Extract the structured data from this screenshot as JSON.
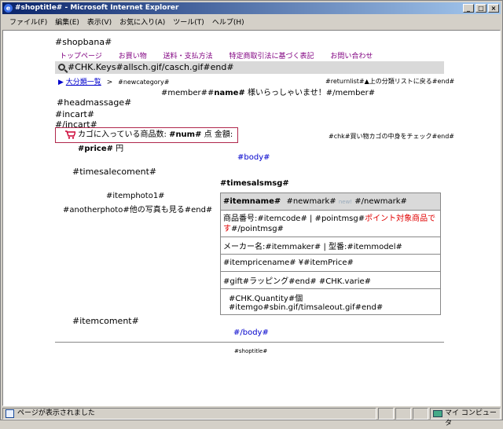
{
  "window": {
    "title": "#shoptitle# - Microsoft Internet Explorer",
    "buttons": [
      "_",
      "□",
      "×"
    ]
  },
  "menu": [
    "ファイル(F)",
    "編集(E)",
    "表示(V)",
    "お気に入り(A)",
    "ツール(T)",
    "ヘルプ(H)"
  ],
  "page": {
    "shopbana": "#shopbana#",
    "nav": [
      "トップページ",
      "お買い物",
      "送料・支払方法",
      "特定商取引法に基づく表記",
      "お問い合わせ"
    ],
    "search": "#CHK.Keys#allsch.gif/casch.gif#end#",
    "breadcrumb_arrow": "▶",
    "breadcrumb_link": "大分類一覧",
    "breadcrumb_sep": ">",
    "newcategory": "#newcategory#",
    "returnlist": "#returnlist#▲上の分類リストに戻る#end#",
    "member_pre": "#member##",
    "member_name": "name#",
    "member_post": " 様いらっしゃいませ！#/member#",
    "headmassage": "#headmassage#",
    "incart": "#incart#",
    "incart_end": "#/incart#",
    "cart_text1": "カゴに入っている商品数: ",
    "cart_num": "#num#",
    "cart_text2": " 点  金額: ",
    "cart_price": "#price#",
    "cart_text3": " 円",
    "chk": "#chk#買い物カゴの中身をチェック#end#",
    "body_open": "#body#",
    "timesalecoment": "#timesalecoment#",
    "timesalsmsg": "#timesalsmsg#",
    "itemphoto": "#itemphoto1#",
    "anotherphoto": "#anotherphoto#他の写真も見る#end#",
    "row1_name": "#itemname#",
    "row1_newmark": "#newmark#",
    "row1_new": "new!",
    "row1_newmark_end": "#/newmark#",
    "row2_a": "商品番号:#itemcode#   | #pointmsg#",
    "row2_red": "ポイント対象商品です",
    "row2_b": "#/pointmsg#",
    "row3": "メーカー名:#itemmaker# | 型番:#itemmodel#",
    "row4": "#itempricename#  ¥#itemPrice#",
    "row5": "#gift#ラッピング#end#  #CHK.varie#",
    "row6": "#CHK.Quantity#個  #itemgo#sbin.gif/timsaleout.gif#end#",
    "itemcoment": "#itemcoment#",
    "body_close": "#/body#",
    "shoptitle_footer": "#shoptitle#"
  },
  "status": {
    "text": "ページが表示されました",
    "zone": "マイ コンピュータ"
  },
  "colors": {
    "nav_link": "#800080",
    "body_tag": "#0000cc",
    "red": "#e00000",
    "title_start": "#0a246a"
  }
}
